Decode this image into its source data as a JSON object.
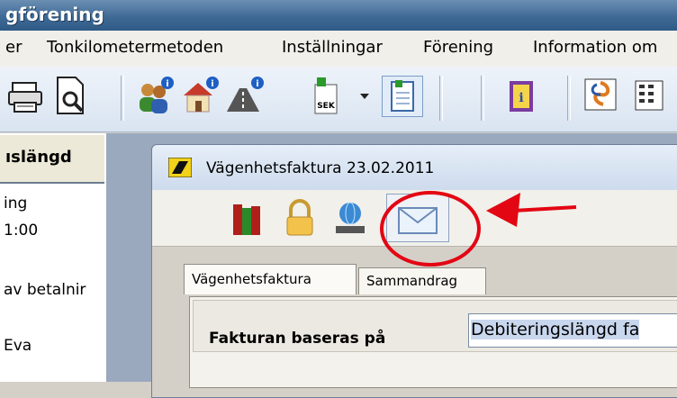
{
  "window": {
    "title": "gförening"
  },
  "menu": [
    "er",
    "Tonkilometermetoden",
    "Inställningar",
    "Förening",
    "Information om"
  ],
  "toolbar": {
    "icons": [
      "printer-icon",
      "print-preview-icon",
      "people-info-icon",
      "house-info-icon",
      "road-info-icon",
      "sek-document-icon",
      "dropdown-arrow-icon",
      "new-document-icon",
      "info-book-icon",
      "hurricane-icon",
      "calculator-icon"
    ]
  },
  "left_panel": {
    "header": "ıslängd",
    "lines": [
      "ing",
      "1:00",
      "av betalnir",
      "Eva"
    ]
  },
  "child_window": {
    "title": "Vägenhetsfaktura  23.02.2011",
    "toolbar_icons": [
      "books-icon",
      "lock-icon",
      "globe-computer-icon",
      "envelope-icon"
    ],
    "tabs": [
      "Vägenhetsfaktura",
      "Sammandrag"
    ],
    "form": {
      "label": "Fakturan baseras på",
      "value": "Debiteringslängd fa"
    }
  },
  "colors": {
    "annotation": "#e30613",
    "title_bar": "#3f6a96",
    "selection": "#c9d7ee"
  }
}
